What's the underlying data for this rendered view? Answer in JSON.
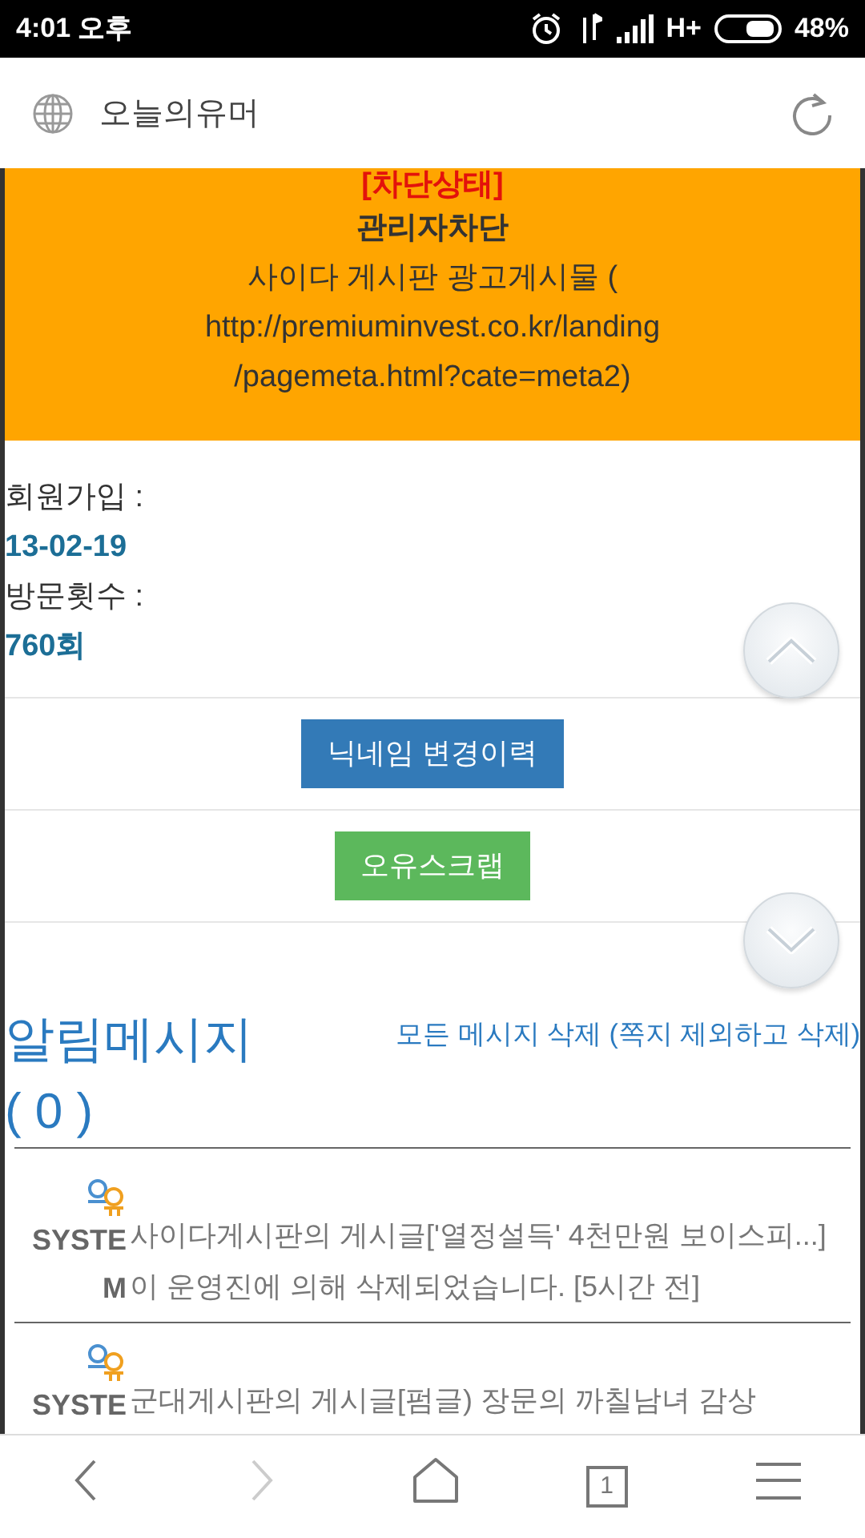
{
  "status_bar": {
    "time": "4:01 오후",
    "network": "H+",
    "battery": "48%"
  },
  "address_bar": {
    "title": "오늘의유머"
  },
  "block_panel": {
    "status": "[차단상태]",
    "reason": "관리자차단",
    "lines": [
      "사이다 게시판 광고게시물 (",
      "http://premiuminvest.co.kr/landing",
      "/pagemeta.html?cate=meta2)"
    ]
  },
  "profile": [
    {
      "label": "회원가입 :",
      "value": "13-02-19"
    },
    {
      "label": "방문횟수 :",
      "value": "760회"
    }
  ],
  "buttons": [
    {
      "label": "닉네임 변경이력",
      "kind": "primary"
    },
    {
      "label": "오유스크랩",
      "kind": "success"
    }
  ],
  "notifications": {
    "title": "알림메시지",
    "count": "( 0 )",
    "delete_link": "모든 메시지 삭제 (쪽지 제외하고 삭제)",
    "items": [
      {
        "sender": "SYSTEM",
        "text": "사이다게시판의 게시글['열정설득' 4천만원 보이스피...]이 운영진에 의해 삭제되었습니다. [5시간 전]"
      },
      {
        "sender": "SYSTE",
        "text": "군대게시판의 게시글[펌글) 장문의 까칠남녀 감상"
      }
    ]
  },
  "bottom_nav": [
    {
      "kind": "back",
      "disabled": false
    },
    {
      "kind": "forward",
      "disabled": true
    },
    {
      "kind": "home",
      "disabled": false
    },
    {
      "kind": "tabs",
      "disabled": false,
      "label": "1"
    },
    {
      "kind": "menu",
      "disabled": false
    }
  ]
}
